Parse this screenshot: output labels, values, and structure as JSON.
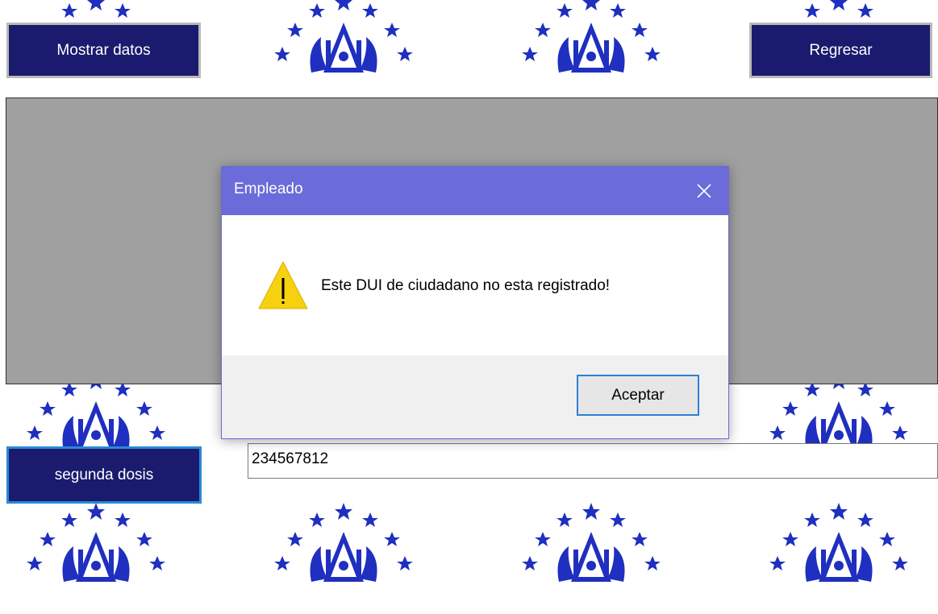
{
  "buttons": {
    "show_data": "Mostrar datos",
    "back": "Regresar",
    "second_dose": "segunda dosis"
  },
  "dui_input": {
    "value": "234567812"
  },
  "dialog": {
    "title": "Empleado",
    "message": "Este DUI de ciudadano no esta registrado!",
    "ok_label": "Aceptar",
    "close_icon": "close-icon",
    "warning_icon": "warning-icon"
  },
  "colors": {
    "navy_button": "#1a1a6e",
    "dialog_title_bar": "#6b6bd9",
    "grid_background": "#a0a0a0",
    "emblem_blue": "#1f2fbf"
  }
}
